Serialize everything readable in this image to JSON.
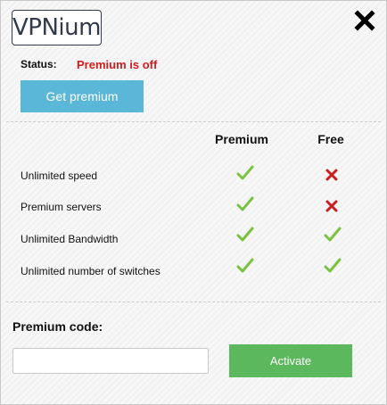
{
  "brand": {
    "logo_text": "VPNium"
  },
  "window": {
    "close_icon": "close-x-icon"
  },
  "status": {
    "label": "Status:",
    "value": "Premium is off",
    "value_color": "#d01c1c"
  },
  "actions": {
    "get_premium_label": "Get premium",
    "activate_label": "Activate"
  },
  "comparison": {
    "columns": [
      "Premium",
      "Free"
    ],
    "rows": [
      {
        "feature": "Unlimited speed",
        "premium": "check",
        "free": "cross"
      },
      {
        "feature": "Premium servers",
        "premium": "check",
        "free": "cross"
      },
      {
        "feature": "Unlimited Bandwidth",
        "premium": "check",
        "free": "check"
      },
      {
        "feature": "Unlimited number of switches",
        "premium": "check",
        "free": "check"
      }
    ],
    "check_color": "#7cc242",
    "cross_color": "#c81e1e"
  },
  "premium_code": {
    "label": "Premium code:",
    "value": "",
    "placeholder": ""
  },
  "colors": {
    "get_premium_bg": "#5ab7d8",
    "activate_bg": "#5cb85c"
  }
}
